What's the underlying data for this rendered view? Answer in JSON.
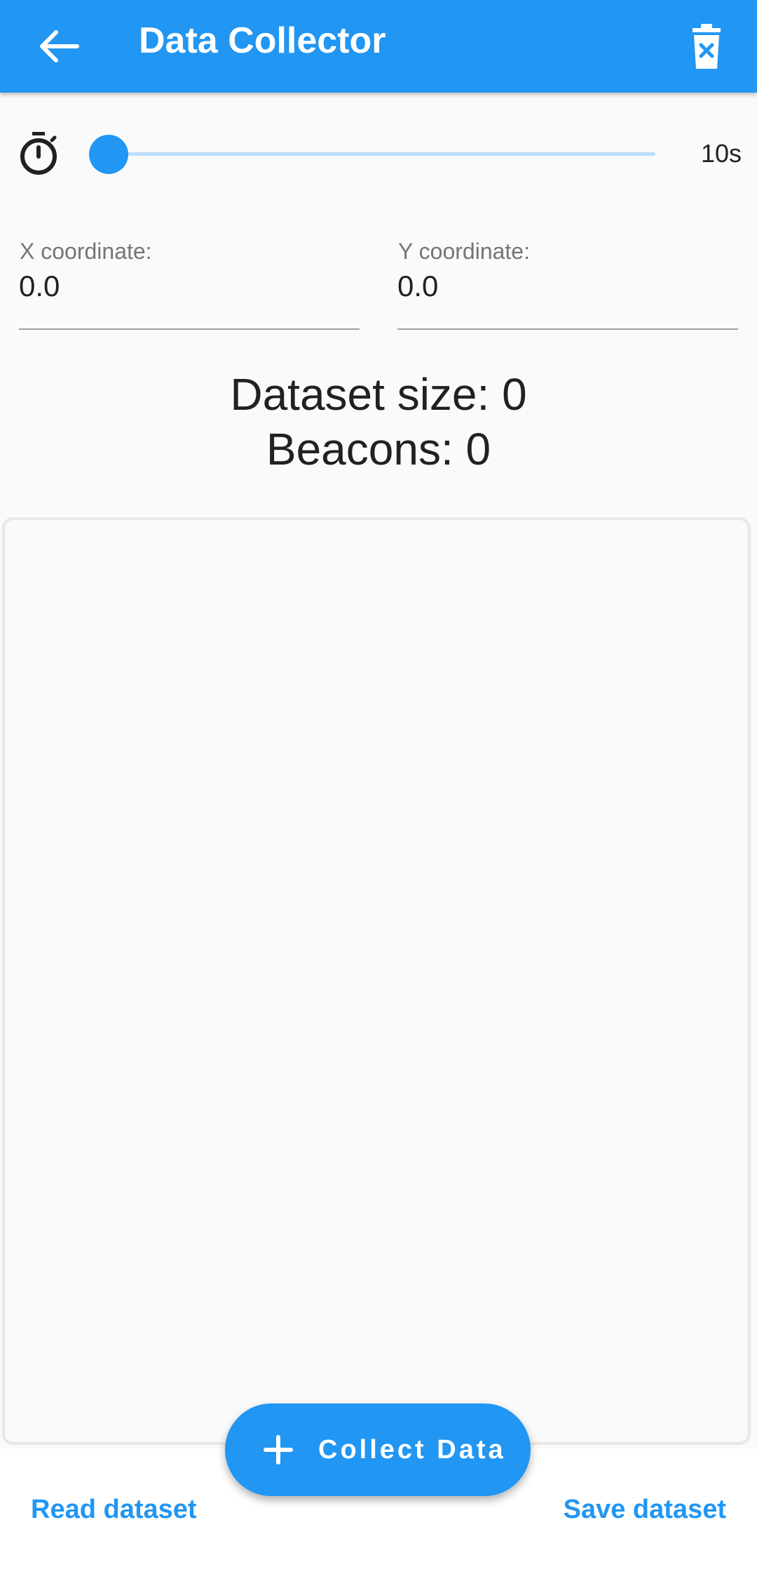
{
  "app_bar": {
    "title": "Data Collector",
    "back_icon": "arrow-back-icon",
    "delete_icon": "delete-forever-icon",
    "color": "#2196f3"
  },
  "timer": {
    "icon": "timer-icon",
    "slider_fraction": 0.0,
    "value_label": "10s"
  },
  "fields": {
    "x": {
      "label": "X coordinate:",
      "value": "0.0"
    },
    "y": {
      "label": "Y coordinate:",
      "value": "0.0"
    }
  },
  "stats": {
    "dataset_size": "Dataset size: 0",
    "beacons": "Beacons: 0"
  },
  "fab": {
    "icon": "add-icon",
    "label": "Collect Data"
  },
  "bottom": {
    "read_label": "Read dataset",
    "save_label": "Save dataset"
  }
}
